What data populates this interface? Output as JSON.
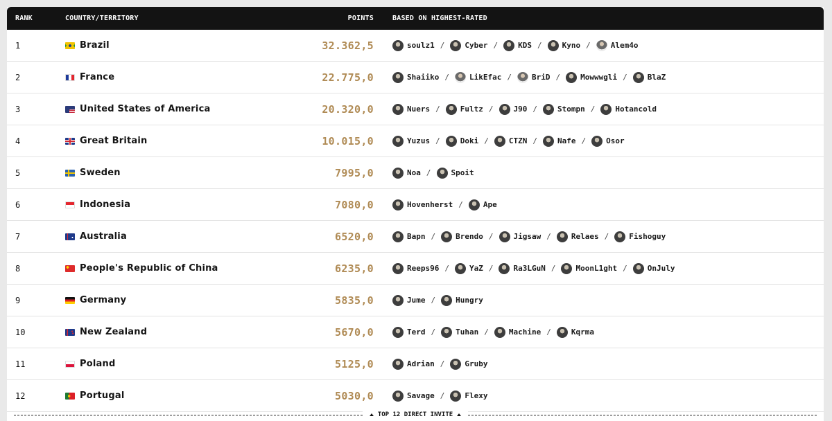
{
  "header": {
    "rank": "RANK",
    "country": "COUNTRY/TERRITORY",
    "points": "POINTS",
    "based": "BASED ON HIGHEST-RATED"
  },
  "rows": [
    {
      "rank": "1",
      "country": "Brazil",
      "flag": "brazil-flag-icon",
      "points": "32.362,5",
      "players": [
        "soulz1",
        "Cyber",
        "KDS",
        "Kyno",
        "Alem4o"
      ]
    },
    {
      "rank": "2",
      "country": "France",
      "flag": "france-flag-icon",
      "points": "22.775,0",
      "players": [
        "Shaiiko",
        "LikEfac",
        "BriD",
        "Mowwwgli",
        "BlaZ"
      ]
    },
    {
      "rank": "3",
      "country": "United States of America",
      "flag": "usa-flag-icon",
      "points": "20.320,0",
      "players": [
        "Nuers",
        "Fultz",
        "J90",
        "Stompn",
        "Hotancold"
      ]
    },
    {
      "rank": "4",
      "country": "Great Britain",
      "flag": "uk-flag-icon",
      "points": "10.015,0",
      "players": [
        "Yuzus",
        "Doki",
        "CTZN",
        "Nafe",
        "Osor"
      ]
    },
    {
      "rank": "5",
      "country": "Sweden",
      "flag": "sweden-flag-icon",
      "points": "7995,0",
      "players": [
        "Noa",
        "Spoit"
      ]
    },
    {
      "rank": "6",
      "country": "Indonesia",
      "flag": "indonesia-flag-icon",
      "points": "7080,0",
      "players": [
        "Hovenherst",
        "Ape"
      ]
    },
    {
      "rank": "7",
      "country": "Australia",
      "flag": "australia-flag-icon",
      "points": "6520,0",
      "players": [
        "Bapn",
        "Brendo",
        "Jigsaw",
        "Relaes",
        "Fishoguy"
      ]
    },
    {
      "rank": "8",
      "country": "People's Republic of China",
      "flag": "china-flag-icon",
      "points": "6235,0",
      "players": [
        "Reeps96",
        "YaZ",
        "Ra3LGuN",
        "MoonL1ght",
        "OnJuly"
      ]
    },
    {
      "rank": "9",
      "country": "Germany",
      "flag": "germany-flag-icon",
      "points": "5835,0",
      "players": [
        "Jume",
        "Hungry"
      ]
    },
    {
      "rank": "10",
      "country": "New Zealand",
      "flag": "newzealand-flag-icon",
      "points": "5670,0",
      "players": [
        "Terd",
        "Tuhan",
        "Machine",
        "Kqrma"
      ]
    },
    {
      "rank": "11",
      "country": "Poland",
      "flag": "poland-flag-icon",
      "points": "5125,0",
      "players": [
        "Adrian",
        "Gruby"
      ]
    },
    {
      "rank": "12",
      "country": "Portugal",
      "flag": "portugal-flag-icon",
      "points": "5030,0",
      "players": [
        "Savage",
        "Flexy"
      ]
    }
  ],
  "footer": {
    "label": "TOP 12 DIRECT INVITE"
  },
  "colors": {
    "points": "#b08b55",
    "header_bg": "#131313"
  }
}
